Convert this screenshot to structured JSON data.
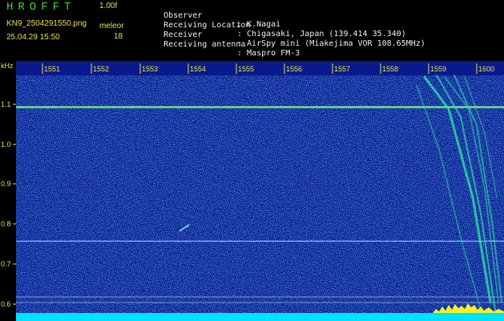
{
  "app": {
    "logo": "HROFFT",
    "version": "1.00f"
  },
  "file": {
    "name": "KN9_2504291550.png",
    "datetime": "25.04.29 15:50"
  },
  "meleor": {
    "label": "meleor",
    "count": "18"
  },
  "info": [
    {
      "label": "Observer",
      "value": ": K.Nagai"
    },
    {
      "label": "Receiving Location",
      "value": ": Chigasaki, Japan (139.414 35.340)"
    },
    {
      "label": "Receiver",
      "value": ": AirSpy mini (Miakejima VOR 108.65MHz)"
    },
    {
      "label": "Receiving antenna",
      "value": ": Maspro FM-3"
    }
  ],
  "waterfall": {
    "unit_label": "kHz",
    "time_ticks": [
      "1551",
      "1552",
      "1553",
      "1554",
      "1555",
      "1556",
      "1557",
      "1558",
      "1559",
      "1600"
    ],
    "freq_ticks": [
      "1.1",
      "1.0",
      "0.9",
      "0.8",
      "0.7",
      "0.6"
    ],
    "colors": {
      "background": "#0a1a8c",
      "noise": "#2a6cff",
      "signal": "#1ee6a8",
      "axis": "#e8e040",
      "baseline": "#00e0ff"
    }
  }
}
